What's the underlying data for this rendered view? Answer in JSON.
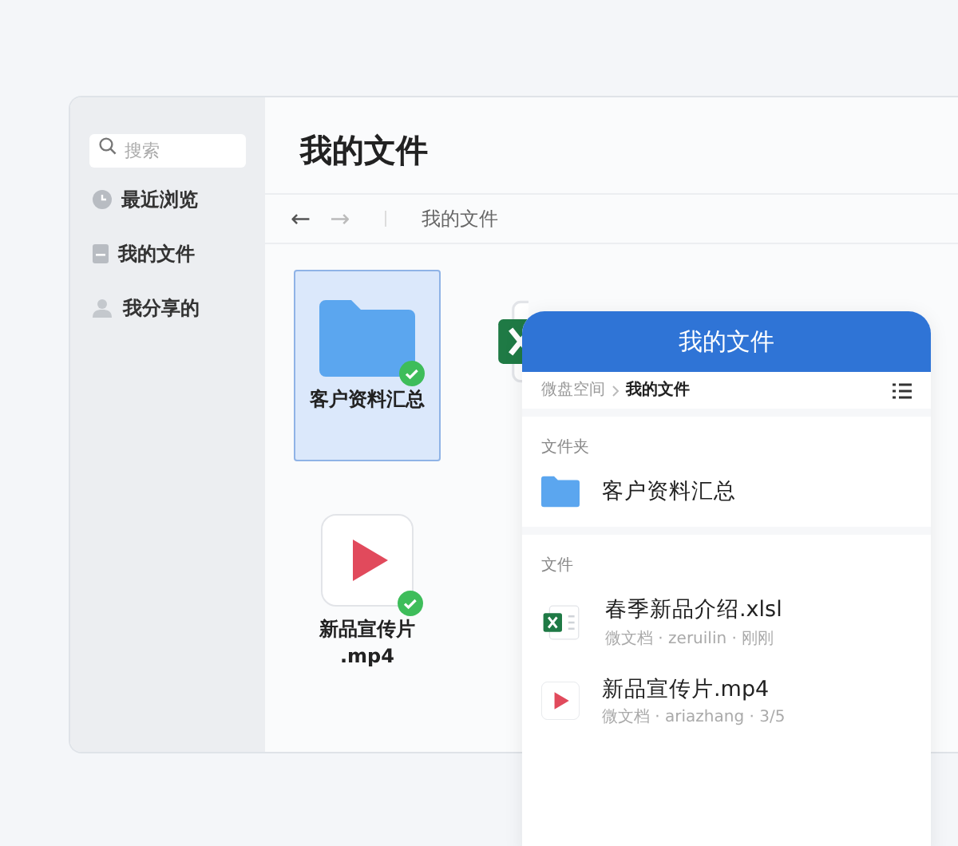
{
  "desktop": {
    "search": {
      "placeholder": "搜索"
    },
    "sidebar": {
      "items": [
        {
          "label": "最近浏览",
          "kind": "clock",
          "selected": false
        },
        {
          "label": "我的文件",
          "kind": "document",
          "selected": false
        },
        {
          "label": "我分享的",
          "kind": "person",
          "selected": false
        }
      ]
    },
    "title": "我的文件",
    "toolbar": {
      "back": "←",
      "forward": "→",
      "path": "我的文件"
    },
    "files": [
      {
        "kind": "folder",
        "name_lines": [
          "客户资料汇总"
        ],
        "selected": true,
        "synced": true
      },
      {
        "kind": "excel"
      },
      {
        "kind": "video",
        "name_lines": [
          "新品宣传片",
          ".mp4"
        ],
        "selected": false,
        "synced": true
      }
    ]
  },
  "mobile": {
    "title": "我的文件",
    "breadcrumb": [
      "微盘空间",
      "我的文件"
    ],
    "sections": [
      {
        "heading": "文件夹",
        "items": [
          {
            "kind": "folder",
            "name": "客户资料汇总"
          }
        ]
      },
      {
        "heading": "文件",
        "items": [
          {
            "kind": "excel",
            "name": "春季新品介绍.xlsl",
            "meta": "微文档 · zeruilin · 刚刚"
          },
          {
            "kind": "video",
            "name": "新品宣传片.mp4",
            "meta": "微文档 · ariazhang · 3/5"
          }
        ]
      }
    ]
  }
}
